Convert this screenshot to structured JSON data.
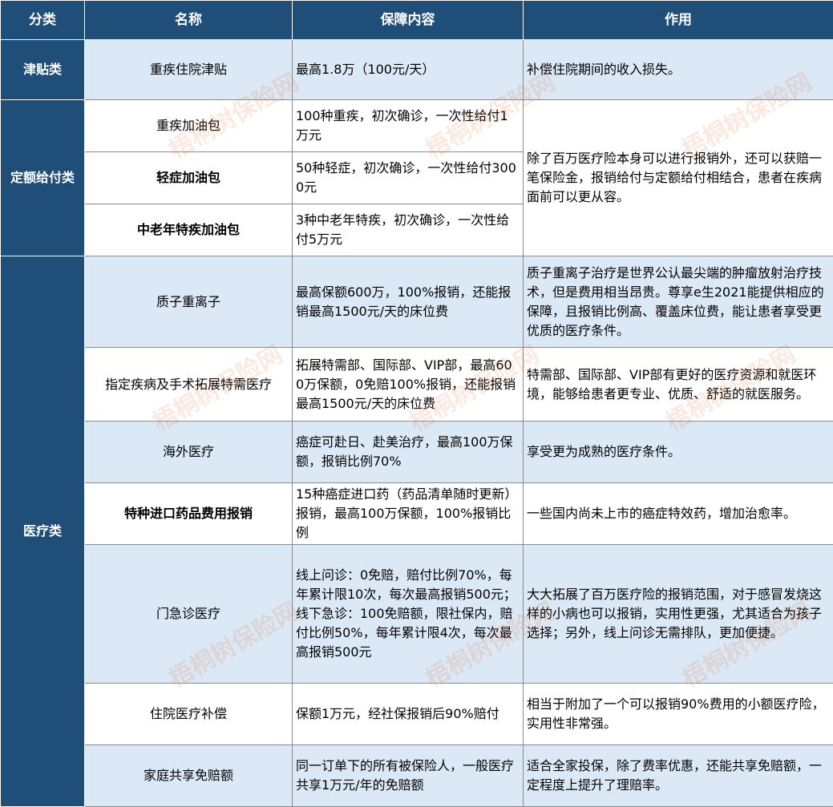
{
  "header": {
    "category": "分类",
    "name": "名称",
    "content": "保障内容",
    "effect": "作用"
  },
  "categories": {
    "allowance": "津贴类",
    "fixed": "定额给付类",
    "medical": "医疗类"
  },
  "rows": [
    {
      "name": "重疾住院津贴",
      "content": "最高1.8万（100元/天）",
      "effect": "补偿住院期间的收入损失。"
    },
    {
      "name": "重疾加油包",
      "content": "100种重疾，初次确诊，一次性给付1万元"
    },
    {
      "name": "轻症加油包",
      "content": "50种轻症，初次确诊，一次性给付3000元"
    },
    {
      "name": "中老年特疾加油包",
      "content": "3种中老年特疾，初次确诊，一次性给付5万元"
    },
    {
      "name": "质子重离子",
      "content": "最高保额600万，100%报销，还能报销最高1500元/天的床位费",
      "effect": "质子重离子治疗是世界公认最尖端的肿瘤放射治疗技术，但是费用相当昂贵。尊享e生2021能提供相应的保障，且报销比例高、覆盖床位费，能让患者享受更优质的医疗条件。"
    },
    {
      "name": "指定疾病及手术拓展特需医疗",
      "content": "拓展特需部、国际部、VIP部，最高600万保额，0免赔100%报销，还能报销最高1500元/天的床位费",
      "effect": "特需部、国际部、VIP部有更好的医疗资源和就医环境，能够给患者更专业、优质、舒适的就医服务。"
    },
    {
      "name": "海外医疗",
      "content": "癌症可赴日、赴美治疗，最高100万保额，报销比例70%",
      "effect": "享受更为成熟的医疗条件。"
    },
    {
      "name": "特种进口药品费用报销",
      "content": "15种癌症进口药（药品清单随时更新）报销，最高100万保额，100%报销比例",
      "effect": "一些国内尚未上市的癌症特效药，增加治愈率。"
    },
    {
      "name": "门急诊医疗",
      "content": "线上问诊：0免赔，赔付比例70%，每年累计限10次，每次最高报销500元；线下急诊：100免赔额，限社保内，赔付比例50%，每年累计限4次，每次最高报销500元",
      "effect": "大大拓展了百万医疗险的报销范围，对于感冒发烧这样的小病也可以报销，实用性更强，尤其适合为孩子选择；另外，线上问诊无需排队，更加便捷。"
    },
    {
      "name": "住院医疗补偿",
      "content": "保额1万元，经社保报销后90%赔付",
      "effect": "相当于附加了一个可以报销90%费用的小额医疗险，实用性非常强。"
    },
    {
      "name": "家庭共享免赔额",
      "content": "同一订单下的所有被保险人，一般医疗共享1万元/年的免赔额",
      "effect": "适合全家投保，除了费率优惠，还能共享免赔额，一定程度上提升了理赔率。"
    }
  ],
  "fixed_effect": "除了百万医疗险本身可以进行报销外，还可以获赔一笔保险金，报销给付与定额给付相结合，患者在疾病面前可以更从容。",
  "watermark": "梧桐树保险网",
  "colors": {
    "header_bg": "#1f4e79",
    "row_shade": "#dbe8f5"
  }
}
